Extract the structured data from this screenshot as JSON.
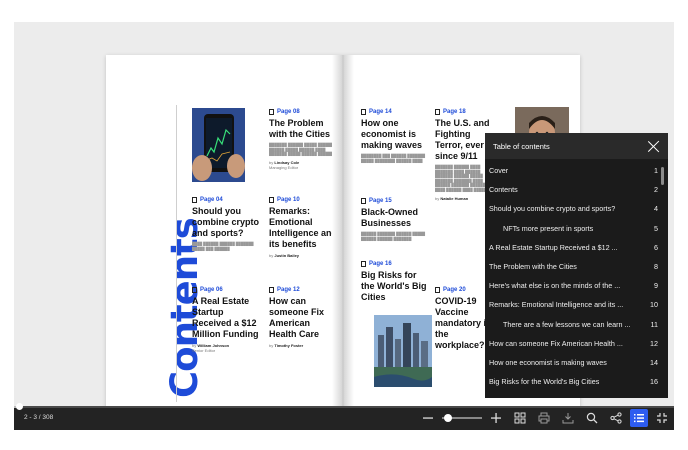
{
  "viewer": {
    "page_indicator": "2 - 3 / 308",
    "progress_fraction": 0.004,
    "zoom_fraction": 0.1,
    "accent_color": "#1e4bd8",
    "toolbar_active_color": "#2d5cf0",
    "icons": [
      "zoom-out-icon",
      "zoom-in-icon",
      "thumbnails-icon",
      "print-icon",
      "download-icon",
      "search-icon",
      "share-icon",
      "toc-icon",
      "fullscreen-exit-icon"
    ]
  },
  "left_page": {
    "title": "Contents",
    "articles": [
      {
        "page": "Page 08",
        "headline": "The Problem with the Cities",
        "byline_prefix": "by",
        "author": "Lindsay Cole",
        "role": "Managing Editor"
      },
      {
        "page": "Page 04",
        "headline": "Should you combine crypto and sports?"
      },
      {
        "page": "Page 10",
        "headline": "Remarks: Emotional Intelligence and its benefits",
        "byline_prefix": "by",
        "author": "Justin Bailey"
      },
      {
        "page": "Page 06",
        "headline": "A Real Estate Startup Received a $12 Million Funding",
        "byline_prefix": "by",
        "author": "William Johnson",
        "role": "Senior Editor"
      },
      {
        "page": "Page 12",
        "headline": "How can someone Fix American Health Care",
        "byline_prefix": "by",
        "author": "Timothy Foster"
      }
    ]
  },
  "right_page": {
    "articles": [
      {
        "page": "Page 14",
        "headline": "How one economist is making waves"
      },
      {
        "page": "Page 18",
        "headline": "The U.S. and Fighting Terror, ever since 9/11",
        "byline_prefix": "by",
        "author": "Natalie Human"
      },
      {
        "page": "Page 15",
        "headline": "Black-Owned Businesses"
      },
      {
        "page": "Page 16",
        "headline": "Big Risks for the World's Big Cities"
      },
      {
        "page": "Page 20",
        "headline": "COVID-19 Vaccine mandatory in the workplace?"
      }
    ]
  },
  "toc": {
    "title": "Table of contents",
    "items": [
      {
        "label": "Cover",
        "page": "1"
      },
      {
        "label": "Contents",
        "page": "2"
      },
      {
        "label": "Should you combine crypto and sports?",
        "page": "4"
      },
      {
        "label": "NFTs more present in sports",
        "page": "5",
        "indent": true
      },
      {
        "label": "A Real Estate Startup Received a $12 ...",
        "page": "6"
      },
      {
        "label": "The Problem with the Cities",
        "page": "8"
      },
      {
        "label": "Here's what else is on the minds of the ...",
        "page": "9"
      },
      {
        "label": "Remarks: Emotional Intelligence and its ...",
        "page": "10"
      },
      {
        "label": "There are a few lessons we can learn ...",
        "page": "11",
        "indent": true
      },
      {
        "label": "How can someone Fix American Health ...",
        "page": "12"
      },
      {
        "label": "How one economist is making waves",
        "page": "14"
      },
      {
        "label": "Big Risks for the World's Big Cities",
        "page": "16"
      }
    ]
  }
}
